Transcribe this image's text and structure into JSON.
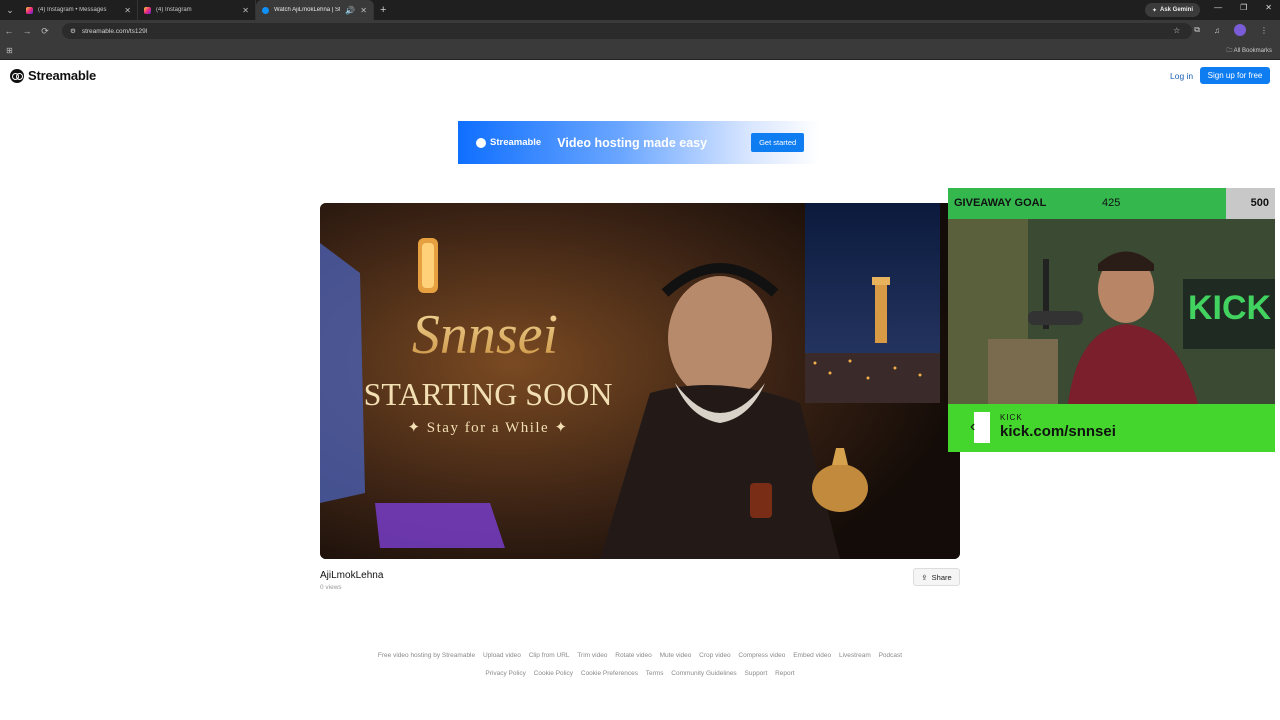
{
  "browser": {
    "tabs": [
      {
        "title": "(4) Instagram • Messages",
        "favicon": "instagram-icon"
      },
      {
        "title": "(4) Instagram",
        "favicon": "instagram-icon"
      },
      {
        "title": "Watch AjiLmokLehna | Strea",
        "favicon": "streamable-icon",
        "active": true
      }
    ],
    "ask_gemini": "Ask Gemini",
    "url": "streamable.com/ts129l",
    "all_bookmarks": "All Bookmarks"
  },
  "header": {
    "logo_text": "Streamable",
    "login": "Log in",
    "signup": "Sign up for free"
  },
  "ad": {
    "logo_text": "Streamable",
    "tagline": "Video hosting made easy",
    "cta": "Get started"
  },
  "video": {
    "thumbnail_title": "Snnsei",
    "thumbnail_subtitle": "STARTING SOON",
    "thumbnail_tagline": "✦ Stay for a While ✦",
    "title": "AjiLmokLehna",
    "views": "0 views",
    "share_label": "Share"
  },
  "overlay": {
    "goal_label": "GIVEAWAY GOAL",
    "goal_current": "425",
    "goal_max": "500",
    "goal_progress": 0.85,
    "kick_small": "KICK",
    "kick_url": "kick.com/snnsei",
    "accent_color": "#44d62c"
  },
  "footer": {
    "row1": [
      "Free video hosting by Streamable",
      "Upload video",
      "Clip from URL",
      "Trim video",
      "Rotate video",
      "Mute video",
      "Crop video",
      "Compress video",
      "Embed video",
      "Livestream",
      "Podcast"
    ],
    "row2": [
      "Privacy Policy",
      "Cookie Policy",
      "Cookie Preferences",
      "Terms",
      "Community Guidelines",
      "Support",
      "Report"
    ]
  }
}
